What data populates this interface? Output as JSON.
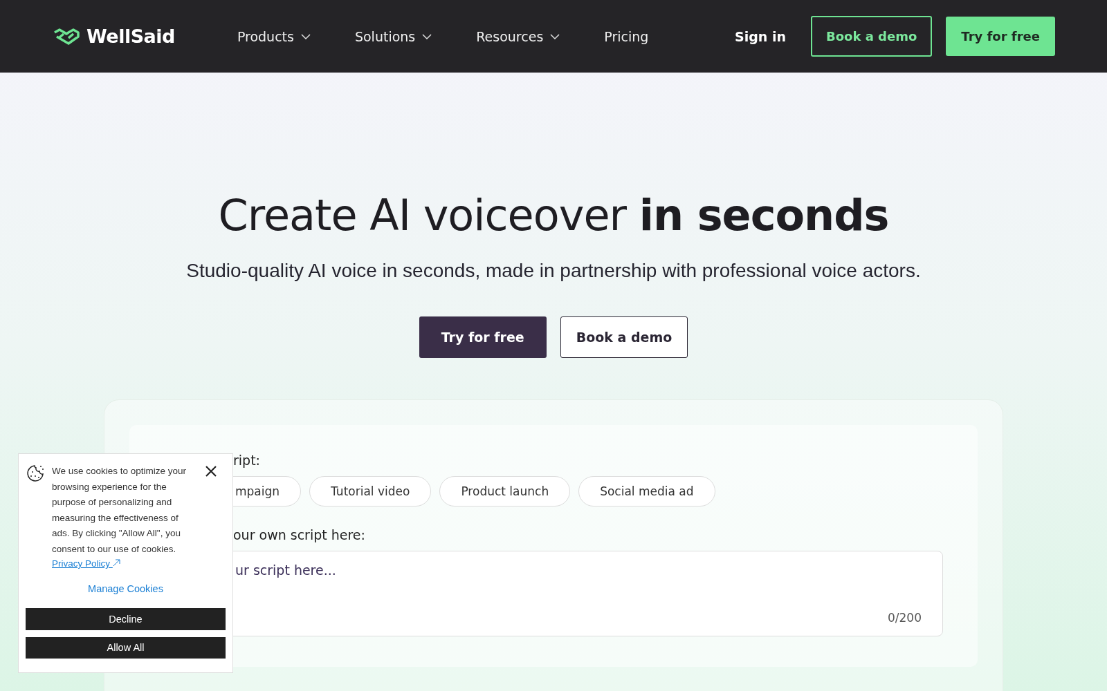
{
  "nav": {
    "brand": "WellSaid",
    "menu": [
      {
        "label": "Products",
        "dropdown": true
      },
      {
        "label": "Solutions",
        "dropdown": true
      },
      {
        "label": "Resources",
        "dropdown": true
      },
      {
        "label": "Pricing",
        "dropdown": false
      }
    ],
    "sign_in": "Sign in",
    "book_demo": "Book a demo",
    "try_free": "Try for free"
  },
  "hero": {
    "title": "Create AI voiceover **in seconds**",
    "subtitle": "Studio-quality AI voice in seconds, made in partnership with professional voice actors.",
    "primary": "Try for free",
    "secondary": "Book a demo"
  },
  "demo": {
    "examples_label": "ript:",
    "examples": [
      {
        "label": "mpaign",
        "selected": false
      },
      {
        "label": "Tutorial video",
        "selected": false
      },
      {
        "label": "Product launch",
        "selected": false
      },
      {
        "label": "Social media ad",
        "selected": false
      }
    ],
    "script_label": "our own script here:",
    "script": {
      "placeholder": "ur script here...",
      "counter": "0/200"
    }
  },
  "cookie_banner": {
    "message": "We use cookies to optimize your browsing experience for the purpose of personalizing and measuring the effectiveness of ads. By clicking \"Allow All\", you consent to our use of cookies.",
    "privacy_link": "Privacy Policy",
    "manage": "Manage Cookies",
    "buttons": [
      "Decline",
      "Allow All"
    ]
  }
}
